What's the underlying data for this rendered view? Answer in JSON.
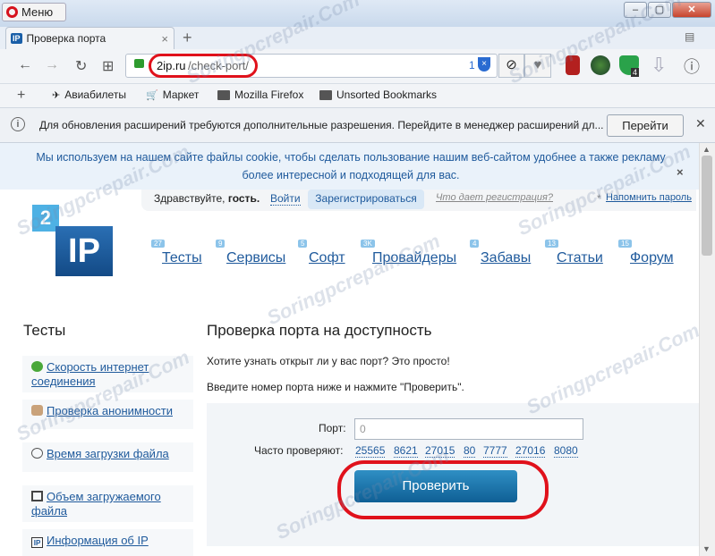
{
  "window": {
    "menu_label": "Меню",
    "minimize": "–",
    "maximize": "▢",
    "close": "✕"
  },
  "tab": {
    "favicon": "IP",
    "title": "Проверка порта",
    "close": "×"
  },
  "newtab_icon": "+",
  "nav": {
    "back_icon": "←",
    "forward_icon": "→",
    "reload_icon": "↻",
    "grid_icon": "⊞",
    "url_host": "2ip.ru",
    "url_path": "/check-port/",
    "url_count": "1",
    "shield_icon": "×",
    "block_icon": "⊘",
    "heart_icon": "♥",
    "ext_badge": "4",
    "download_icon": "⇩",
    "menu_icon": "ⓘ"
  },
  "bookmarks": [
    {
      "icon": "plane-icon",
      "label": "Авиабилеты"
    },
    {
      "icon": "cart-icon",
      "label": "Маркет"
    },
    {
      "icon": "folder-icon",
      "label": "Mozilla Firefox"
    },
    {
      "icon": "folder-icon",
      "label": "Unsorted Bookmarks"
    }
  ],
  "notification": {
    "text": "Для обновления расширений требуются дополнительные разрешения. Перейдите в менеджер расширений дл...",
    "button": "Перейти",
    "close": "✕"
  },
  "cookie": {
    "text": "Мы используем на нашем сайте файлы cookie, чтобы сделать пользование нашим веб-сайтом удобнее а также рекламу более интересной и подходящей для вас.",
    "close": "×"
  },
  "userbar": {
    "greeting": "Здравствуйте,",
    "guest": "гость.",
    "login": "Войти",
    "register": "Зарегистрироваться",
    "what_reg": "Что дает регистрация?",
    "star": "*",
    "remind": "Напомнить пароль"
  },
  "logo": {
    "top": "2",
    "main": "IP"
  },
  "site_nav": [
    {
      "label": "Тесты",
      "badge": "27"
    },
    {
      "label": "Сервисы",
      "badge": "9"
    },
    {
      "label": "Софт",
      "badge": "5"
    },
    {
      "label": "Провайдеры",
      "badge": "3K"
    },
    {
      "label": "Забавы",
      "badge": "4"
    },
    {
      "label": "Статьи",
      "badge": "13"
    },
    {
      "label": "Форум",
      "badge": "15"
    }
  ],
  "sidebar": {
    "title": "Тесты",
    "items": [
      "Скорость интернет соединения",
      "Проверка анонимности",
      "Время загрузки файла",
      "Объем загружаемого файла",
      "Информация об IP"
    ]
  },
  "main": {
    "title": "Проверка порта на доступность",
    "intro": "Хотите узнать открыт ли у вас порт? Это просто!",
    "instructions": "Введите номер порта ниже и нажмите \"Проверить\".",
    "port_label": "Порт:",
    "port_placeholder": "0",
    "often_label": "Часто проверяют:",
    "ports": [
      "25565",
      "8621",
      "27015",
      "80",
      "7777",
      "27016",
      "8080"
    ],
    "check_button": "Проверить"
  },
  "watermark": "Soringpcrepair.Com"
}
